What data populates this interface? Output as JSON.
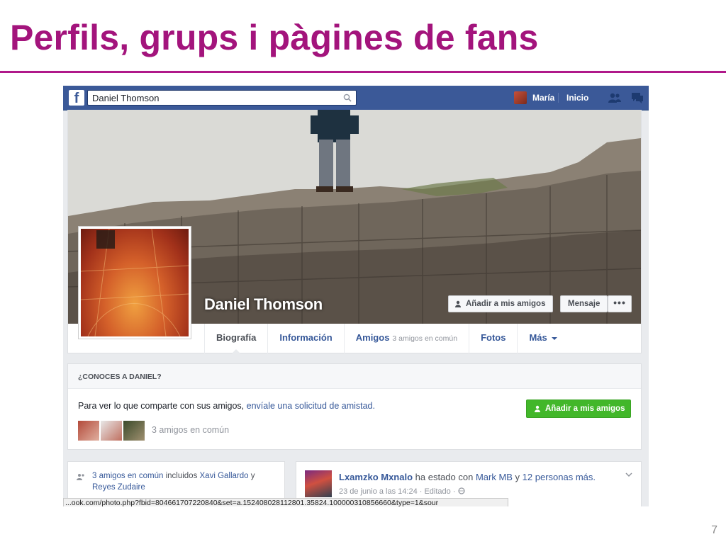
{
  "slide": {
    "title": "Perfils, grups i pàgines de fans",
    "page_number": "7"
  },
  "topbar": {
    "search_value": "Daniel Thomson",
    "user_name": "María",
    "home_label": "Inicio"
  },
  "profile": {
    "name": "Daniel Thomson",
    "add_friend_label": "Añadir a mis amigos",
    "message_label": "Mensaje",
    "more_label": "•••"
  },
  "tabs": [
    {
      "label": "Biografía",
      "sub": ""
    },
    {
      "label": "Información",
      "sub": ""
    },
    {
      "label": "Amigos",
      "sub": "3 amigos en común"
    },
    {
      "label": "Fotos",
      "sub": ""
    },
    {
      "label": "Más",
      "sub": ""
    }
  ],
  "know": {
    "title": "¿CONOCES A DANIEL?",
    "text_prefix": "Para ver lo que comparte con sus amigos, ",
    "text_link": "envíale una solicitud de amistad.",
    "add_friend_label": "Añadir a mis amigos",
    "mutual_text": "3 amigos en común"
  },
  "left_card": {
    "count_link": "3 amigos en común",
    "included": " incluidos ",
    "friend1": "Xavi Gallardo",
    "and": " y ",
    "friend2": "Reyes Zudaire"
  },
  "post": {
    "author": "Lxamzko Mxnalo",
    "middle": " ha estado con ",
    "tag1": "Mark MB",
    "and": " y ",
    "tag2": "12 personas más.",
    "meta": "23 de junio a las 14:24 · Editado · "
  },
  "statusbar_url": "...ook.com/photo.php?fbid=804661707220840&set=a.152408028112801.35824.100000310856660&type=1&sour"
}
